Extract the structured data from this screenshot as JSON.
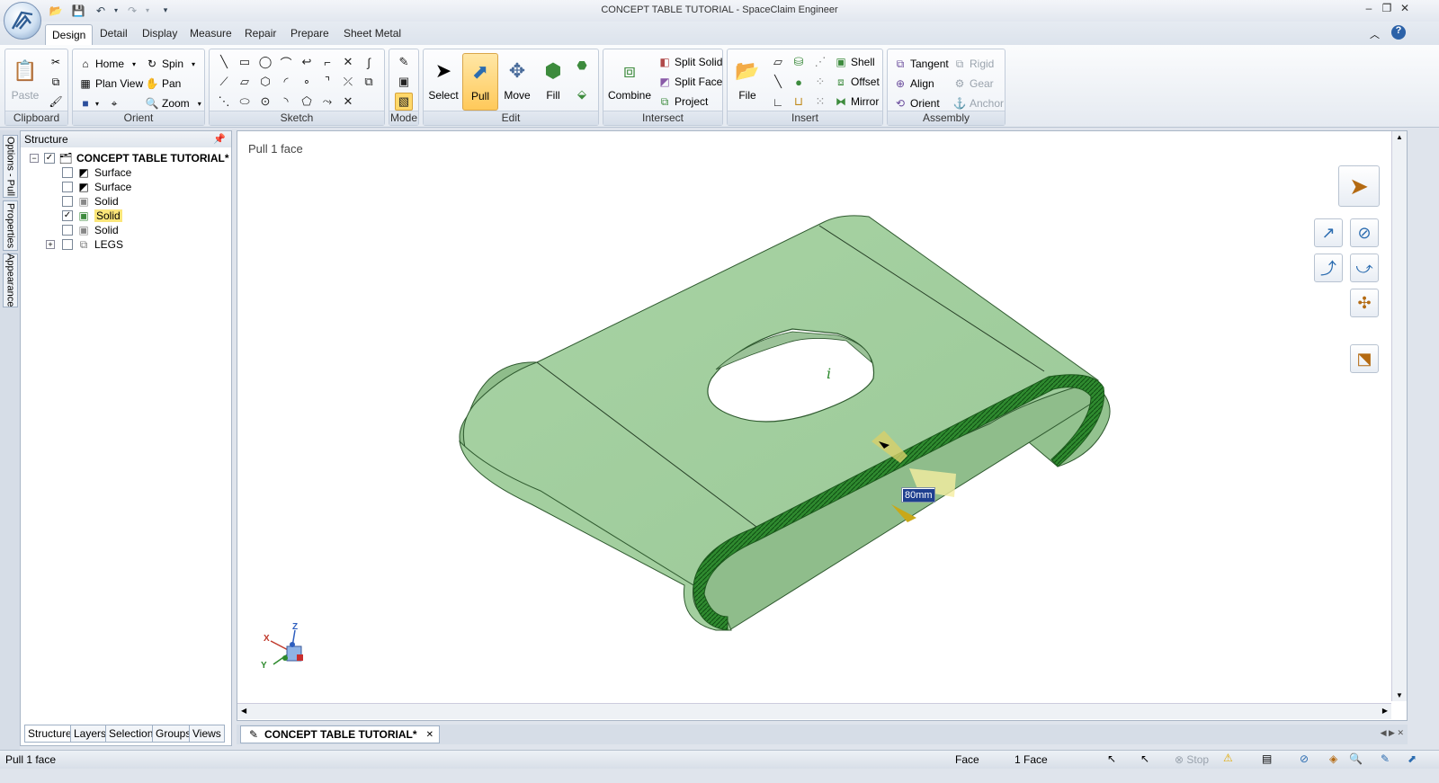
{
  "window": {
    "title": "CONCEPT TABLE TUTORIAL - SpaceClaim Engineer"
  },
  "quick_access": {
    "icons": [
      "open-icon",
      "save-icon",
      "undo-icon",
      "redo-icon"
    ]
  },
  "menu_tabs": [
    "Design",
    "Detail",
    "Display",
    "Measure",
    "Repair",
    "Prepare",
    "Sheet Metal"
  ],
  "ribbon": {
    "clipboard": {
      "label": "Clipboard",
      "paste": "Paste"
    },
    "orient": {
      "label": "Orient",
      "home": "Home",
      "plan_view": "Plan View",
      "spin": "Spin",
      "pan": "Pan",
      "zoom": "Zoom"
    },
    "sketch": {
      "label": "Sketch"
    },
    "mode": {
      "label": "Mode"
    },
    "edit": {
      "label": "Edit",
      "select": "Select",
      "pull": "Pull",
      "move": "Move",
      "fill": "Fill"
    },
    "intersect": {
      "label": "Intersect",
      "combine": "Combine",
      "split_solid": "Split Solid",
      "split_face": "Split Face",
      "project": "Project"
    },
    "insert": {
      "label": "Insert",
      "file": "File",
      "shell": "Shell",
      "offset": "Offset",
      "mirror": "Mirror"
    },
    "assembly": {
      "label": "Assembly",
      "tangent": "Tangent",
      "align": "Align",
      "orient": "Orient",
      "rigid": "Rigid",
      "gear": "Gear",
      "anchor": "Anchor"
    }
  },
  "side_tabs": {
    "options": "Options - Pull",
    "properties": "Properties",
    "appearance": "Appearance"
  },
  "structure": {
    "title": "Structure",
    "root": "CONCEPT TABLE TUTORIAL*",
    "items": [
      {
        "label": "Surface",
        "checked": false
      },
      {
        "label": "Surface",
        "checked": false
      },
      {
        "label": "Solid",
        "checked": false
      },
      {
        "label": "Solid",
        "checked": true
      },
      {
        "label": "Solid",
        "checked": false
      },
      {
        "label": "LEGS",
        "checked": false
      }
    ],
    "bottom_tabs": [
      "Structure",
      "Layers",
      "Selection",
      "Groups",
      "Views"
    ]
  },
  "viewport": {
    "hint": "Pull 1 face",
    "dimension": "80mm",
    "axis_labels": {
      "x": "X",
      "y": "Y",
      "z": "Z"
    },
    "model_color": "#a8d3a4"
  },
  "document_tab": "CONCEPT TABLE TUTORIAL*",
  "status": {
    "left": "Pull 1 face",
    "filter": "Face",
    "selection": "1 Face",
    "stop": "Stop"
  }
}
